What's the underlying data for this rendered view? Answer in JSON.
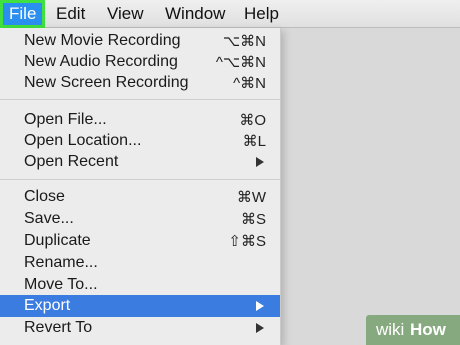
{
  "menubar": {
    "items": [
      "File",
      "Edit",
      "View",
      "Window",
      "Help"
    ]
  },
  "file_menu": {
    "groups": [
      [
        {
          "label": "New Movie Recording",
          "shortcut": "⌥⌘N"
        },
        {
          "label": "New Audio Recording",
          "shortcut": "^⌥⌘N"
        },
        {
          "label": "New Screen Recording",
          "shortcut": "^⌘N"
        }
      ],
      [
        {
          "label": "Open File...",
          "shortcut": "⌘O"
        },
        {
          "label": "Open Location...",
          "shortcut": "⌘L"
        },
        {
          "label": "Open Recent",
          "submenu": true
        }
      ],
      [
        {
          "label": "Close",
          "shortcut": "⌘W"
        },
        {
          "label": "Save...",
          "shortcut": "⌘S"
        },
        {
          "label": "Duplicate",
          "shortcut": "⇧⌘S"
        },
        {
          "label": "Rename...",
          "shortcut": ""
        },
        {
          "label": "Move To...",
          "shortcut": ""
        },
        {
          "label": "Export",
          "submenu": true,
          "highlighted": true
        },
        {
          "label": "Revert To",
          "submenu": true
        }
      ]
    ]
  },
  "watermark": {
    "prefix": "wiki",
    "suffix": "How"
  },
  "colors": {
    "accent_blue": "#3a7ce0",
    "active_menu_blue": "#2b8ff0",
    "focus_outline_green": "#3fe03f",
    "menu_background": "#ececec",
    "desktop_background": "#d9d9d9"
  }
}
